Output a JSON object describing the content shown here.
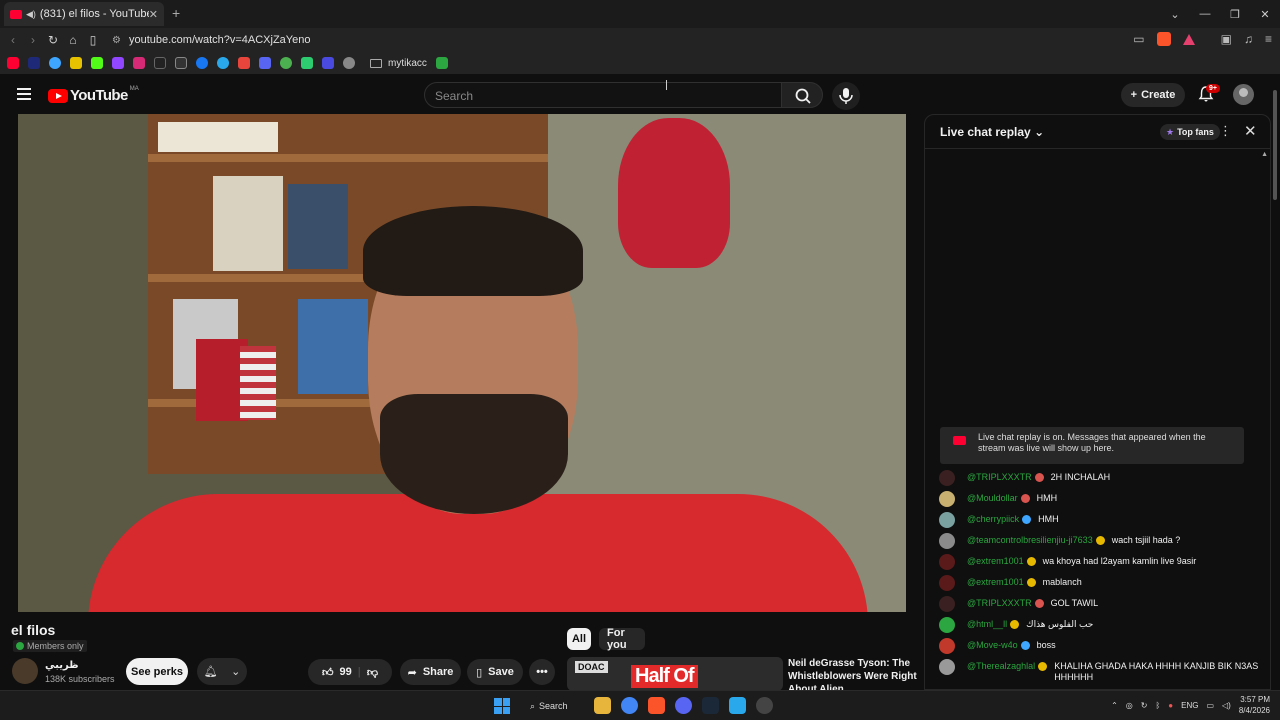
{
  "browser": {
    "tab_title": "(831) el filos - YouTube",
    "url": "youtube.com/watch?v=4ACXjZaYeno",
    "bookmark_folder": "mytikacc"
  },
  "header": {
    "logo_text": "YouTube",
    "country_code": "MA",
    "search_placeholder": "Search",
    "create_label": "Create",
    "notif_count": "9+"
  },
  "video": {
    "title": "el filos",
    "members_label": "Members only",
    "channel_name": "ظريبي",
    "subscribers": "138K subscribers",
    "see_perks": "See perks",
    "likes": "99",
    "share": "Share",
    "save": "Save"
  },
  "chips": {
    "all": "All",
    "for_you": "For you"
  },
  "recommendation": {
    "badge": "DOAC",
    "thumb_text": "Half Of",
    "title": "Neil deGrasse Tyson: The Whistleblowers Were Right About Alien..."
  },
  "chat": {
    "title": "Live chat replay",
    "top_fans": "Top fans",
    "notice": "Live chat replay is on. Messages that appeared when the stream was live will show up here.",
    "messages": [
      {
        "author": "@TRIPLXXXTR",
        "text": "2H INCHALAH",
        "avatar_color": "#3a2020",
        "badge_color": "#d9534f"
      },
      {
        "author": "@Mouldollar",
        "text": "HMH",
        "avatar_color": "#c8b070",
        "badge_color": "#d9534f"
      },
      {
        "author": "@cherrypiick",
        "text": "HMH",
        "avatar_color": "#7aa0a0",
        "badge_color": "#3ea6ff"
      },
      {
        "author": "@teamcontrolbresilienjiu-ji7633",
        "text": "wach tsjiil hada ?",
        "avatar_color": "#8a8a8a",
        "badge_color": "#e6b800"
      },
      {
        "author": "@extrem1001",
        "text": "wa khoya had l2ayam kamlin live 9asir",
        "avatar_color": "#5a1a1a",
        "badge_color": "#e6b800"
      },
      {
        "author": "@extrem1001",
        "text": "mablanch",
        "avatar_color": "#5a1a1a",
        "badge_color": "#e6b800"
      },
      {
        "author": "@TRIPLXXXTR",
        "text": "GOL TAWIL",
        "avatar_color": "#3a2020",
        "badge_color": "#d9534f"
      },
      {
        "author": "@html__ll",
        "text": "حب الفلوس هذاك",
        "avatar_color": "#2ba640",
        "badge_color": "#e6b800"
      },
      {
        "author": "@Move-w4o",
        "text": "boss",
        "avatar_color": "#c0392b",
        "badge_color": "#3ea6ff"
      },
      {
        "author": "@Therealzaghlal",
        "text": "KHALIHA GHADA HAKA HHHH KANJIB BIK N3AS HHHHHH",
        "avatar_color": "#999999",
        "badge_color": "#e6b800"
      }
    ]
  },
  "taskbar": {
    "search_label": "Search",
    "language": "ENG",
    "time": "3:57 PM",
    "date": "8/4/2026"
  }
}
